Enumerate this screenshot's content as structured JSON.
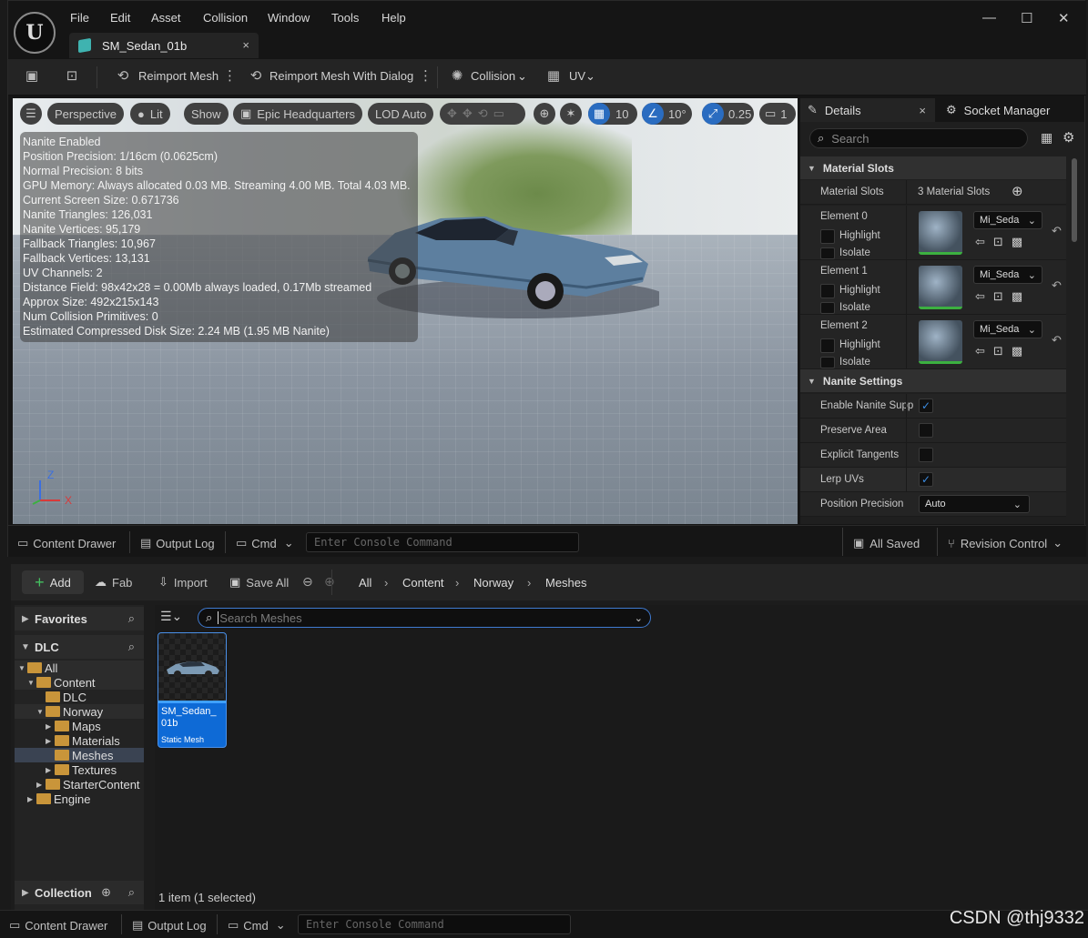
{
  "editor": {
    "menu": [
      "File",
      "Edit",
      "Asset",
      "Collision",
      "Window",
      "Tools",
      "Help"
    ],
    "tab_title": "SM_Sedan_01b",
    "tab_close": "×",
    "window_buttons": {
      "minimize": "—",
      "maximize": "☐",
      "close": "✕"
    },
    "toolbar": {
      "reimport_mesh": "Reimport Mesh",
      "reimport_with_dialog": "Reimport Mesh With Dialog",
      "collision": "Collision",
      "uv": "UV"
    }
  },
  "viewport": {
    "perspective": "Perspective",
    "lit": "Lit",
    "show": "Show",
    "epic_hq": "Epic Headquarters",
    "lod": "LOD Auto",
    "grid_snap": "10",
    "rotation_snap": "10°",
    "scale_snap": "0.25",
    "camera_speed": "1",
    "axis_z": "Z",
    "axis_x": "X",
    "stats": [
      "Nanite Enabled",
      "Position Precision: 1/16cm (0.0625cm)",
      "Normal Precision: 8 bits",
      "GPU Memory: Always allocated 0.03 MB. Streaming 4.00 MB. Total 4.03 MB.",
      "Current Screen Size: 0.671736",
      "Nanite Triangles: 126,031",
      "Nanite Vertices: 95,179",
      "Fallback Triangles: 10,967",
      "Fallback Vertices: 13,131",
      "UV Channels: 2",
      "Distance Field: 98x42x28 = 0.00Mb always loaded, 0.17Mb streamed",
      "Approx Size: 492x215x143",
      "Num Collision Primitives: 0",
      "Estimated Compressed Disk Size: 2.24 MB (1.95 MB Nanite)"
    ]
  },
  "details": {
    "tab_details": "Details",
    "tab_close": "×",
    "tab_socket_manager": "Socket Manager",
    "search_placeholder": "Search",
    "material_slots_header": "Material Slots",
    "material_slots_label": "Material Slots",
    "material_slots_value": "3 Material Slots",
    "elements": [
      {
        "label": "Element 0",
        "material": "Mi_Seda",
        "highlight": "Highlight",
        "isolate": "Isolate"
      },
      {
        "label": "Element 1",
        "material": "Mi_Seda",
        "highlight": "Highlight",
        "isolate": "Isolate"
      },
      {
        "label": "Element 2",
        "material": "Mi_Seda",
        "highlight": "Highlight",
        "isolate": "Isolate"
      }
    ],
    "nanite_header": "Nanite Settings",
    "nanite_rows": [
      {
        "label": "Enable Nanite Supp",
        "checked": true
      },
      {
        "label": "Preserve Area",
        "checked": false
      },
      {
        "label": "Explicit Tangents",
        "checked": false
      },
      {
        "label": "Lerp UVs",
        "checked": true
      }
    ],
    "position_precision_label": "Position Precision",
    "position_precision_value": "Auto"
  },
  "editor_status": {
    "content_drawer": "Content Drawer",
    "output_log": "Output Log",
    "cmd": "Cmd",
    "console_placeholder": "Enter Console Command",
    "all_saved": "All Saved",
    "revision_control": "Revision Control"
  },
  "content_browser": {
    "add": "Add",
    "fab": "Fab",
    "import": "Import",
    "save_all": "Save All",
    "breadcrumb": [
      "All",
      "Content",
      "Norway",
      "Meshes"
    ],
    "favorites": "Favorites",
    "dlc_header": "DLC",
    "tree": [
      {
        "label": "All",
        "indent": 0,
        "open": true
      },
      {
        "label": "Content",
        "indent": 1,
        "open": true
      },
      {
        "label": "DLC",
        "indent": 2,
        "open": false,
        "leaf": true
      },
      {
        "label": "Norway",
        "indent": 2,
        "open": true
      },
      {
        "label": "Maps",
        "indent": 3,
        "open": false
      },
      {
        "label": "Materials",
        "indent": 3,
        "open": false
      },
      {
        "label": "Meshes",
        "indent": 3,
        "open": false,
        "leaf": true,
        "selected": true
      },
      {
        "label": "Textures",
        "indent": 3,
        "open": false
      },
      {
        "label": "StarterContent",
        "indent": 2,
        "open": false
      },
      {
        "label": "Engine",
        "indent": 1,
        "open": false
      }
    ],
    "collection": "Collection",
    "search_placeholder": "Search Meshes",
    "asset_name": "SM_Sedan_01b",
    "asset_name_line1": "SM_Sedan_",
    "asset_name_line2": "01b",
    "asset_type": "Static Mesh",
    "item_count": "1 item (1 selected)"
  },
  "bottom_status": {
    "content_drawer": "Content Drawer",
    "output_log": "Output Log",
    "cmd": "Cmd",
    "console_placeholder": "Enter Console Command"
  },
  "watermark": "CSDN @thj9332",
  "colors": {
    "accent_blue": "#0e6ad6",
    "folder": "#c9953a",
    "check": "#3b8be0",
    "add_green": "#44c060"
  }
}
